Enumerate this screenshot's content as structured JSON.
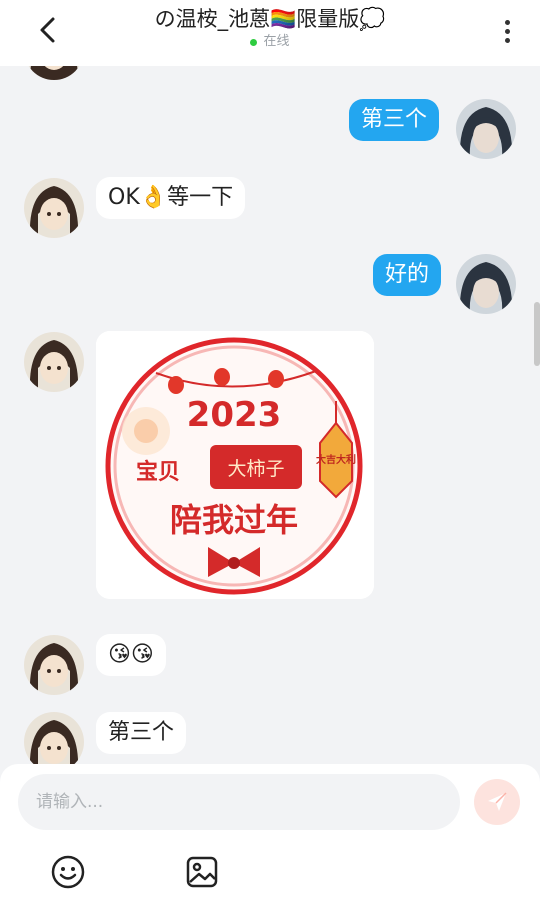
{
  "header": {
    "title": "の温桉_池蒽🏳️‍🌈限量版💭",
    "status": "在线"
  },
  "messages": [
    {
      "side": "incoming",
      "text": "OK👌等一下"
    },
    {
      "side": "outgoing",
      "text": "第三个"
    },
    {
      "side": "outgoing",
      "text": "好的"
    },
    {
      "side": "incoming",
      "type": "sticker",
      "sticker": {
        "year": "2023",
        "left_text": "宝贝",
        "name": "大柿子",
        "bottom_text": "陪我过年",
        "tag_text": "大吉大利"
      }
    },
    {
      "side": "incoming",
      "text": "😘😘"
    },
    {
      "side": "incoming",
      "text": "第三个"
    }
  ],
  "composer": {
    "placeholder": "请输入..."
  },
  "icons": {
    "back": "chevron-left-icon",
    "menu": "more-vertical-icon",
    "send": "send-icon",
    "emoji": "emoji-icon",
    "image": "image-icon"
  },
  "colors": {
    "outgoing_bubble": "#23a6f0",
    "incoming_bubble": "#ffffff",
    "background": "#f2f3f5",
    "online": "#2ecc40",
    "sticker_red": "#d42a2a"
  }
}
